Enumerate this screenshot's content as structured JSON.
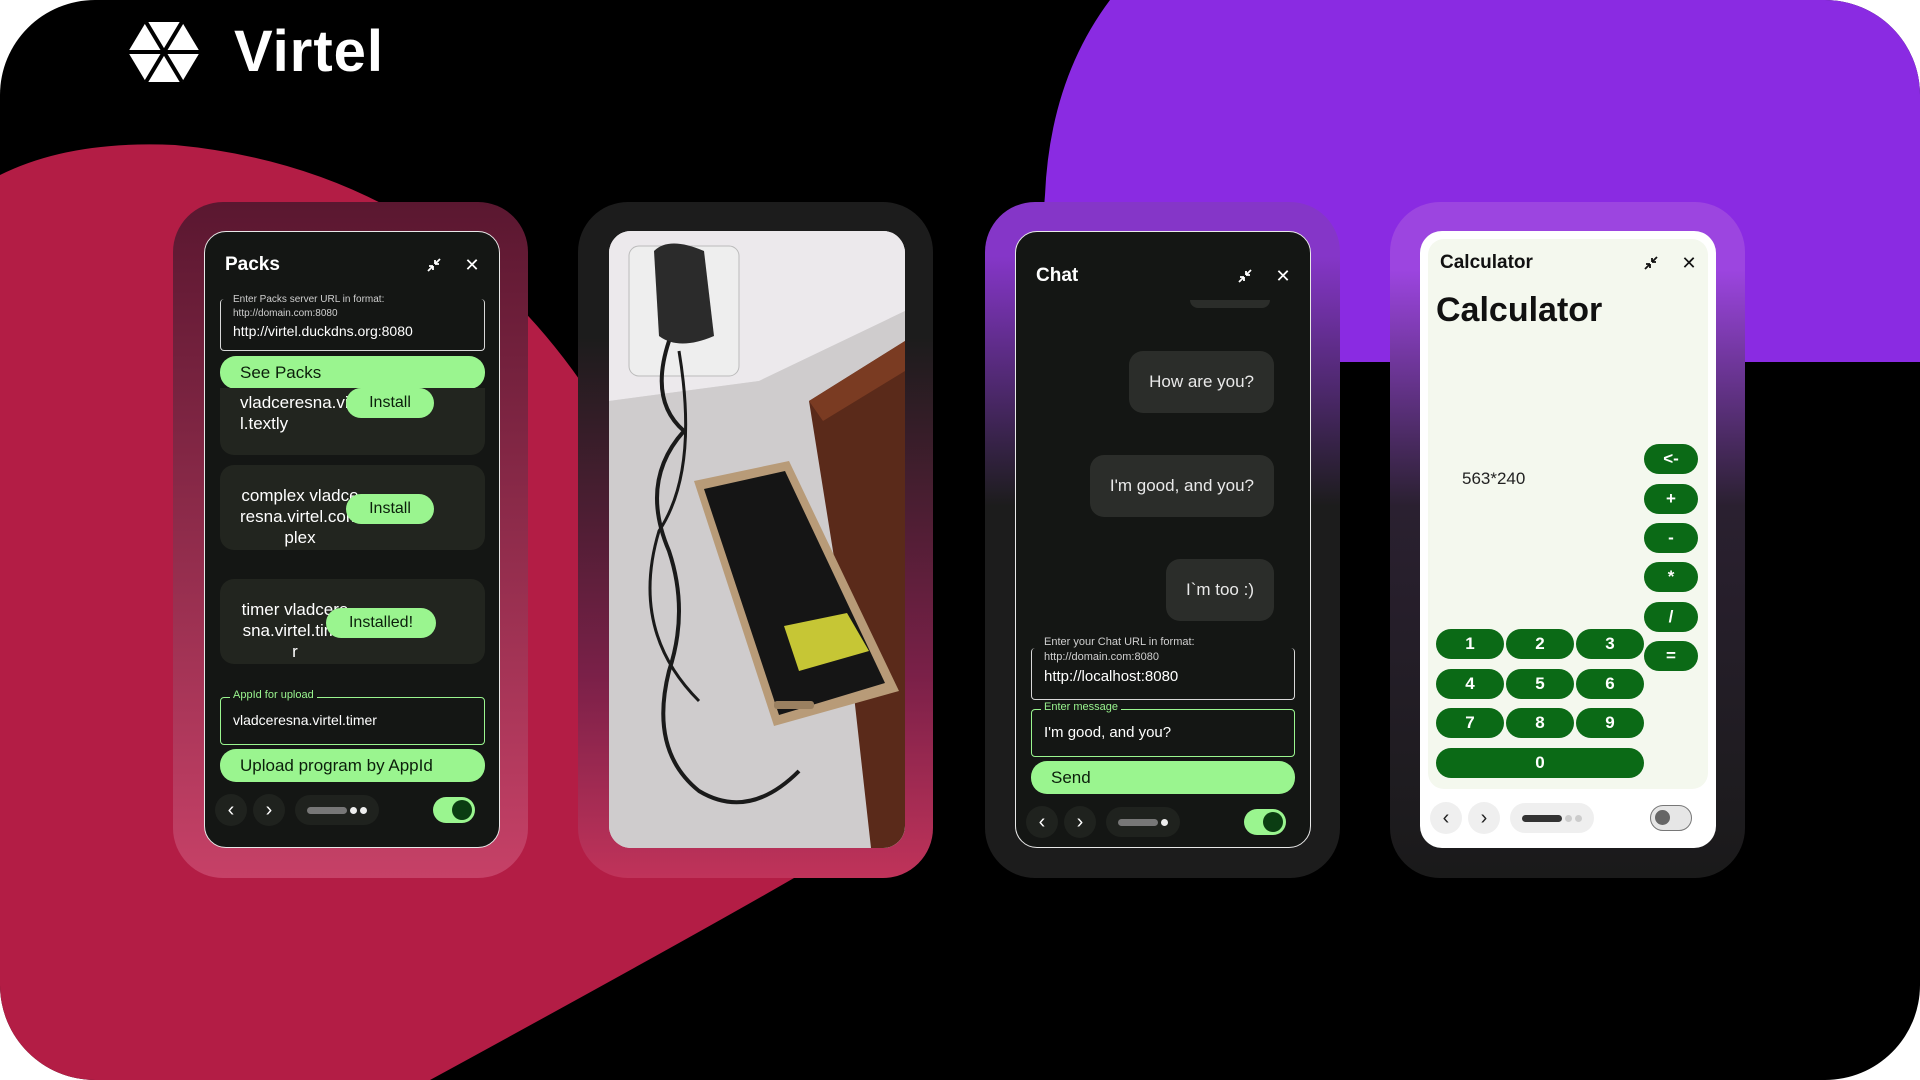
{
  "brand": {
    "name": "Virtel",
    "colors": {
      "purple": "#8a2be2",
      "crimson": "#b31d45",
      "green": "#9af58f",
      "dark_green": "#0b6a16"
    }
  },
  "packs": {
    "title": "Packs",
    "url_field": {
      "label": "Enter Packs server URL in format:",
      "hint": "http://domain.com:8080",
      "value": "http://virtel.duckdns.org:8080"
    },
    "see_button": "See Packs",
    "items": [
      {
        "name": "vladceresna.virtel.textly",
        "action": "Install"
      },
      {
        "name": "complex vladceresna.virtel.complex",
        "action": "Install"
      },
      {
        "name": "timer vladceresna.virtel.timer",
        "action": "Installed!"
      }
    ],
    "upload_field": {
      "label": "AppId for upload",
      "value": "vladceresna.virtel.timer"
    },
    "upload_button": "Upload program by AppId"
  },
  "chat": {
    "title": "Chat",
    "messages": [
      "How are you?",
      "I'm good, and you?",
      "I`m too :)"
    ],
    "url_field": {
      "label": "Enter your Chat URL in format:",
      "hint": "http://domain.com:8080",
      "value": "http://localhost:8080"
    },
    "message_field": {
      "label": "Enter message",
      "value": "I'm good, and you?"
    },
    "send_button": "Send"
  },
  "calculator": {
    "title": "Calculator",
    "heading": "Calculator",
    "expression": "563*240",
    "operators": [
      "<-",
      "+",
      "-",
      "*",
      "/",
      "="
    ],
    "digits": [
      "1",
      "2",
      "3",
      "4",
      "5",
      "6",
      "7",
      "8",
      "9",
      "0"
    ]
  },
  "icons": [
    "minimize-icon",
    "close-icon",
    "chevron-left-icon",
    "chevron-right-icon"
  ]
}
